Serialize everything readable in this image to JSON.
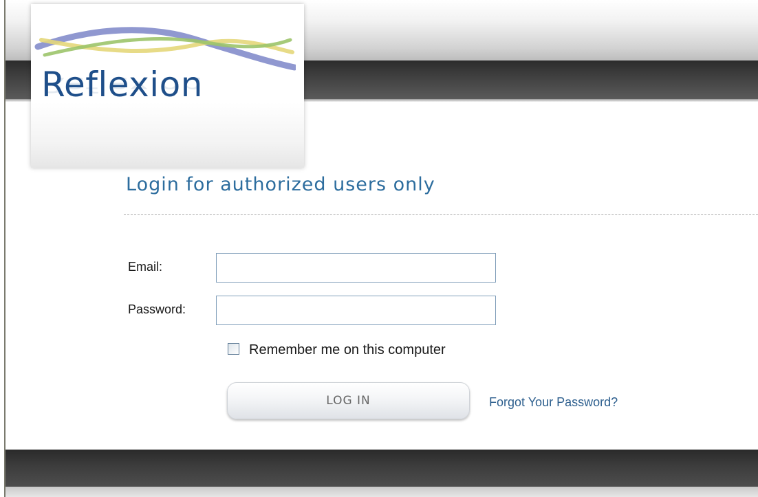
{
  "brand": {
    "logo_text": "Reflexion",
    "colors": {
      "logo_blue": "#1f4f8a",
      "heading_blue": "#2d6d9e",
      "link_blue": "#2d5f8e",
      "wave_blue": "#7c86c8",
      "wave_yellow": "#e4d77a",
      "wave_green": "#9cc46a"
    }
  },
  "login": {
    "heading": "Login for authorized users only",
    "email_label": "Email:",
    "email_value": "",
    "password_label": "Password:",
    "password_value": "",
    "remember_label": "Remember me on this computer",
    "remember_checked": false,
    "login_button": "LOG IN",
    "forgot_link": "Forgot Your Password?"
  }
}
